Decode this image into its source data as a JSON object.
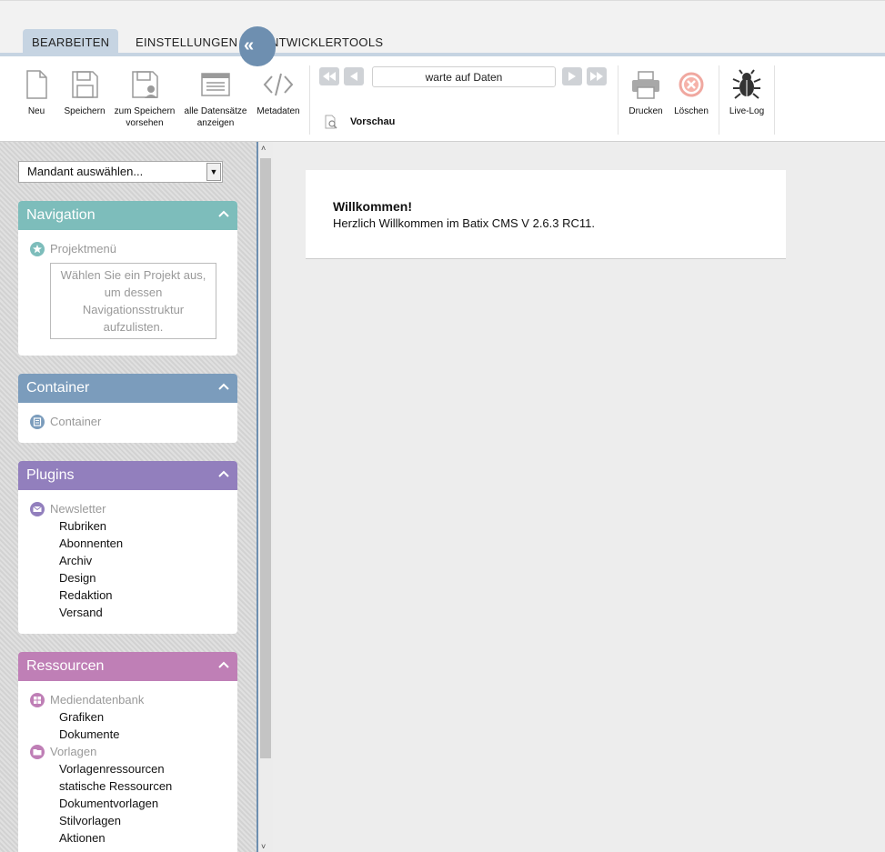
{
  "tabs": [
    {
      "label": "BEARBEITEN",
      "active": true
    },
    {
      "label": "EINSTELLUNGEN",
      "active": false
    },
    {
      "label": "ENTWICKLERTOOLS",
      "active": false
    }
  ],
  "toolbar": {
    "new_label": "Neu",
    "save_label": "Speichern",
    "save_prepare_label": "zum Speichern vorsehen",
    "all_records_label": "alle Datensätze anzeigen",
    "metadata_label": "Metadaten",
    "record_status": "warte auf Daten",
    "preview_label": "Vorschau",
    "print_label": "Drucken",
    "delete_label": "Löschen",
    "livelog_label": "Live-Log"
  },
  "sidebar": {
    "mandant_select": "Mandant auswählen...",
    "collapse_glyph": "«",
    "navigation": {
      "title": "Navigation",
      "group": "Projektmenü",
      "hint": "Wählen Sie ein Projekt aus, um dessen Navigationsstruktur aufzulisten."
    },
    "container": {
      "title": "Container",
      "group": "Container"
    },
    "plugins": {
      "title": "Plugins",
      "group": "Newsletter",
      "items": [
        "Rubriken",
        "Abonnenten",
        "Archiv",
        "Design",
        "Redaktion",
        "Versand"
      ]
    },
    "resources": {
      "title": "Ressourcen",
      "group1": "Mediendatenbank",
      "group1_items": [
        "Grafiken",
        "Dokumente"
      ],
      "group2": "Vorlagen",
      "group2_items": [
        "Vorlagenressourcen",
        "statische Ressourcen",
        "Dokumentvorlagen",
        "Stilvorlagen",
        "Aktionen"
      ]
    }
  },
  "main": {
    "welcome_title": "Willkommen!",
    "welcome_text": "Herzlich Willkommen im Batix CMS V 2.6.3 RC11."
  },
  "colors": {
    "navigation": "#7dbdbb",
    "container": "#7b9cbc",
    "plugins": "#927fbd",
    "resources": "#bf7fb6",
    "tab_active": "#c6d4e2",
    "accent_blue": "#6e8fb0"
  }
}
